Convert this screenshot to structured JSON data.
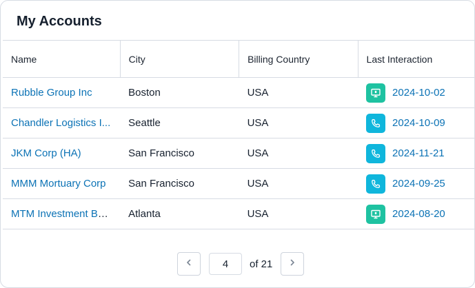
{
  "card": {
    "title": "My Accounts"
  },
  "table": {
    "headers": [
      "Name",
      "City",
      "Billing Country",
      "Last Interaction"
    ],
    "rows": [
      {
        "name": "Rubble Group Inc",
        "city": "Boston",
        "country": "USA",
        "interaction_type": "monitor-icon",
        "interaction_color": "#1ec2a1",
        "date": "2024-10-02"
      },
      {
        "name": "Chandler Logistics I...",
        "city": "Seattle",
        "country": "USA",
        "interaction_type": "phone-icon",
        "interaction_color": "#0fb6dc",
        "date": "2024-10-09"
      },
      {
        "name": "JKM Corp (HA)",
        "city": "San Francisco",
        "country": "USA",
        "interaction_type": "phone-icon",
        "interaction_color": "#0fb6dc",
        "date": "2024-11-21"
      },
      {
        "name": "MMM Mortuary Corp",
        "city": "San Francisco",
        "country": "USA",
        "interaction_type": "phone-icon",
        "interaction_color": "#0fb6dc",
        "date": "2024-09-25"
      },
      {
        "name": "MTM Investment Ba...",
        "city": "Atlanta",
        "country": "USA",
        "interaction_type": "monitor-icon",
        "interaction_color": "#1ec2a1",
        "date": "2024-08-20"
      }
    ]
  },
  "pagination": {
    "current_page": "4",
    "of_text": "of 21"
  },
  "colors": {
    "link": "#0b72b5",
    "border": "#d6dbe3",
    "text": "#16202e"
  }
}
